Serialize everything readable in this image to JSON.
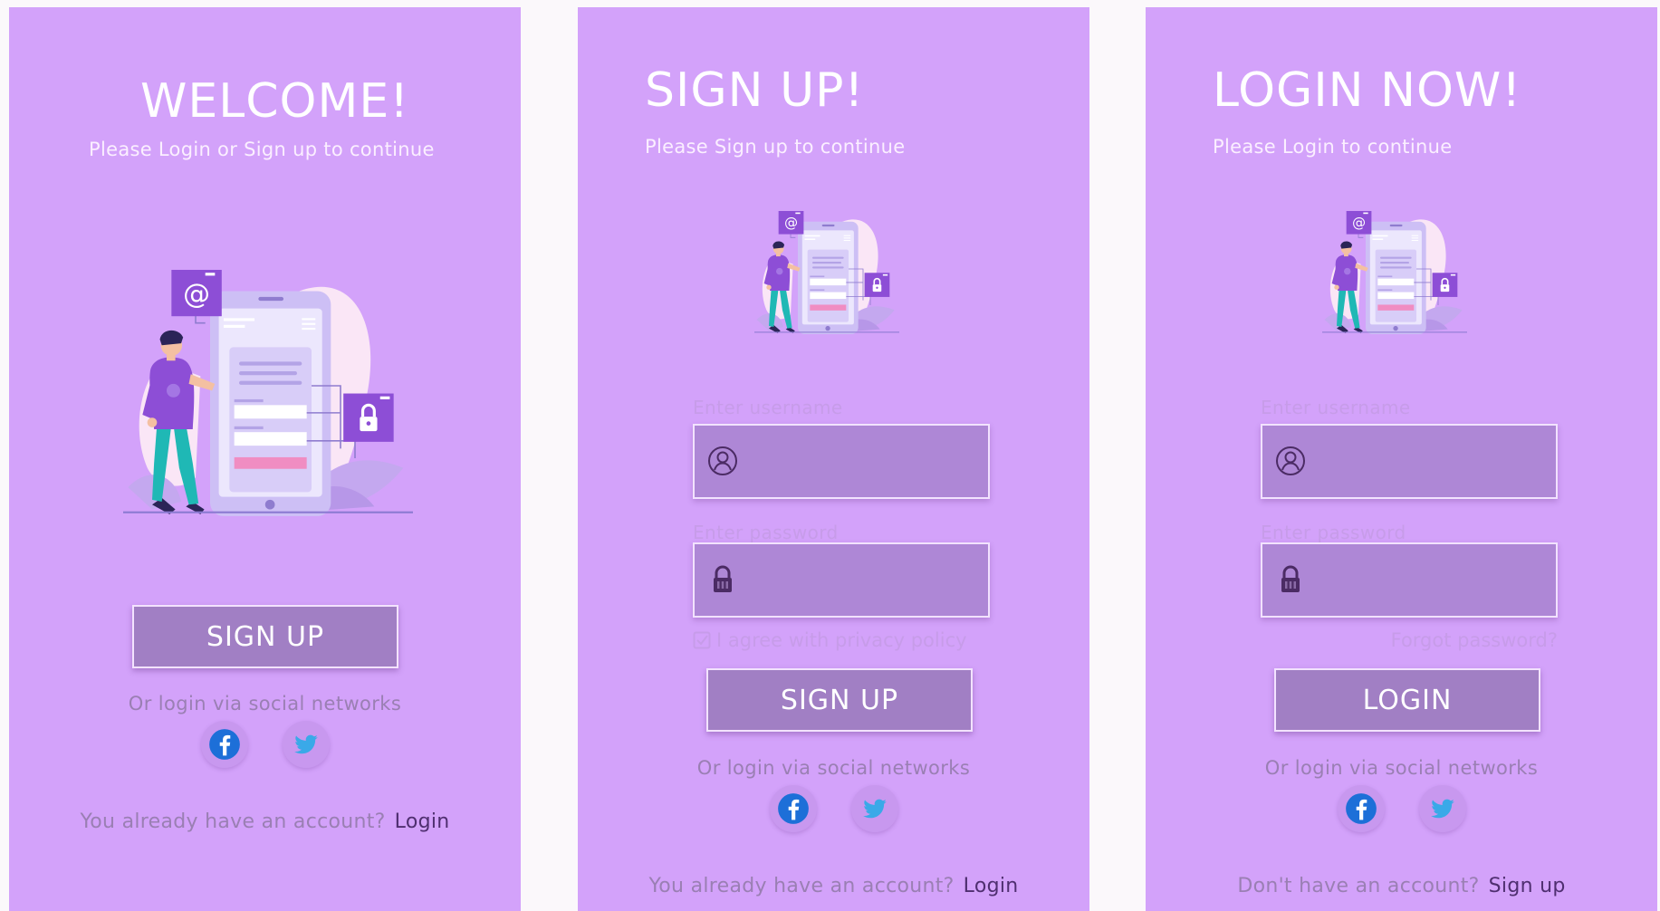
{
  "welcome": {
    "title": "WELCOME!",
    "subtitle": "Please Login or Sign up to continue",
    "signup_button": "SIGN UP",
    "social_text": "Or login via social networks",
    "account_question": "You already have an account?",
    "account_link": "Login"
  },
  "signup": {
    "title": "SIGN UP!",
    "subtitle": "Please Sign up to continue",
    "username_label": "Enter username",
    "password_label": "Enter password",
    "agree_text": "I agree with privacy policy",
    "signup_button": "SIGN UP",
    "social_text": "Or login via social networks",
    "account_question": "You already have an account?",
    "account_link": "Login"
  },
  "login": {
    "title": "LOGIN NOW!",
    "subtitle": "Please Login to continue",
    "username_label": "Enter username",
    "password_label": "Enter password",
    "forgot_text": "Forgot password?",
    "login_button": "LOGIN",
    "social_text": "Or login via social networks",
    "account_question": "Don't have an account?",
    "account_link": "Sign up"
  },
  "icons": {
    "at": "at-icon",
    "lock": "lock-icon",
    "user": "user-circle-icon",
    "facebook": "facebook-icon",
    "twitter": "twitter-icon",
    "checkbox": "checkbox-checked-icon"
  },
  "colors": {
    "panel_bg": "#d3a2fa",
    "button_bg": "#a17fc4",
    "field_bg": "#ae87d6",
    "facebook": "#1d6fd8",
    "twitter": "#3aa9e8",
    "link": "#4f2f70"
  }
}
